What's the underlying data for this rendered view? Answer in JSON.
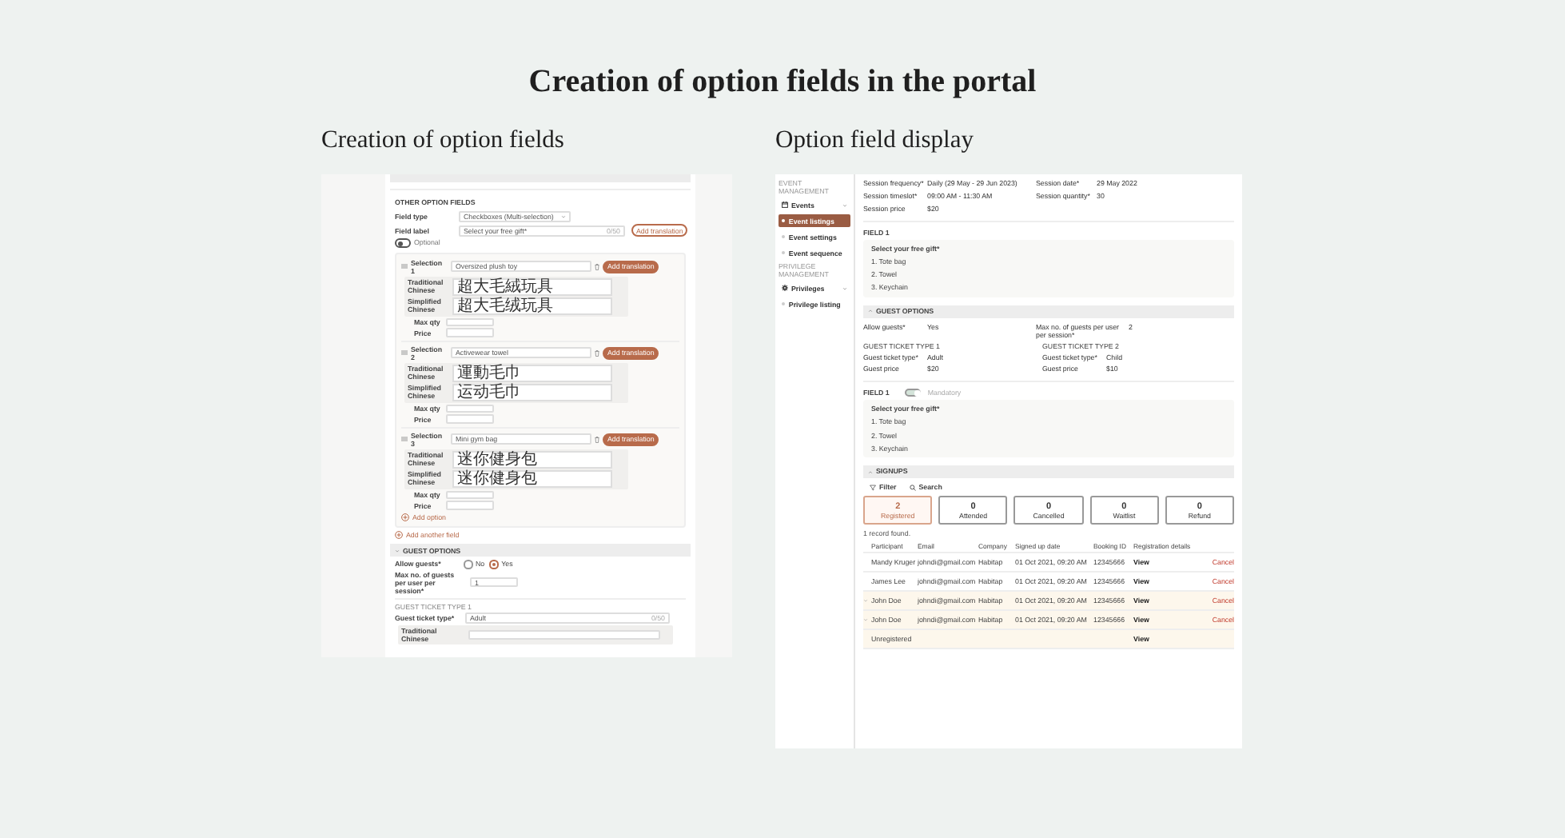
{
  "heading": "Creation of option fields in the portal",
  "creation_panel": {
    "caption": "Creation of option fields",
    "section_title": "OTHER OPTION FIELDS",
    "field_type": {
      "label": "Field type",
      "value": "Checkboxes (Multi-selection)"
    },
    "field_label": {
      "label": "Field label",
      "value": "Select your free gift*",
      "counter": "0/50",
      "button": "Add translation"
    },
    "optional_toggle": {
      "label": "Optional",
      "on": false
    },
    "selections": [
      {
        "label": "Selection 1",
        "value": "Oversized plush toy",
        "button": "Add translation",
        "translations": [
          {
            "label": "Traditional Chinese",
            "value": "超大毛絨玩具"
          },
          {
            "label": "Simplified Chinese",
            "value": "超大毛绒玩具"
          }
        ],
        "max_qty_label": "Max qty",
        "price_label": "Price"
      },
      {
        "label": "Selection 2",
        "value": "Activewear towel",
        "button": "Add translation",
        "translations": [
          {
            "label": "Traditional Chinese",
            "value": "運動毛巾"
          },
          {
            "label": "Simplified Chinese",
            "value": "运动毛巾"
          }
        ],
        "max_qty_label": "Max qty",
        "price_label": "Price"
      },
      {
        "label": "Selection 3",
        "value": "Mini gym bag",
        "button": "Add translation",
        "translations": [
          {
            "label": "Traditional Chinese",
            "value": "迷你健身包"
          },
          {
            "label": "Simplified Chinese",
            "value": "迷你健身包"
          }
        ],
        "max_qty_label": "Max qty",
        "price_label": "Price"
      }
    ],
    "add_option": "Add option",
    "add_field": "Add another field",
    "guest_options": {
      "title": "GUEST OPTIONS",
      "allow_label": "Allow guests*",
      "radios": [
        {
          "label": "No",
          "selected": false
        },
        {
          "label": "Yes",
          "selected": true
        }
      ],
      "max_label": "Max no. of guests per user per session*",
      "max_value": "1",
      "ticket_title": "GUEST TICKET TYPE 1",
      "ticket_label": "Guest ticket type*",
      "ticket_value": "Adult",
      "ticket_counter": "0/50",
      "translation_label": "Traditional Chinese"
    }
  },
  "display_panel": {
    "caption": "Option field display",
    "sidebar": [
      {
        "title": "EVENT MANAGEMENT",
        "parent": "Events",
        "items": [
          {
            "label": "Event listings",
            "selected": true
          },
          {
            "label": "Event settings",
            "selected": false
          },
          {
            "label": "Event sequence",
            "selected": false
          }
        ]
      },
      {
        "title": "PRIVILEGE MANAGEMENT",
        "parent": "Privileges",
        "items": [
          {
            "label": "Privilege listing",
            "selected": false
          }
        ]
      }
    ],
    "sections": [
      {
        "kind": "session",
        "rows": [
          {
            "label": "Session frequency*",
            "value": "Daily (29 May - 29 Jun 2023)"
          },
          {
            "label": "Session date*",
            "value": "29 May 2022"
          },
          {
            "label": "Session timeslot*",
            "value": "09:00 AM - 11:30 AM"
          },
          {
            "label": "Session quantity*",
            "value": "30"
          },
          {
            "label": "Session price",
            "value": "$20"
          }
        ]
      },
      {
        "kind": "field",
        "title": "FIELD 1",
        "question": "Select your free gift*",
        "options": [
          "1.  Tote bag",
          "2.  Towel",
          "3.  Keychain"
        ]
      },
      {
        "kind": "guest_options",
        "title": "GUEST OPTIONS",
        "rows": [
          {
            "label": "Allow guests*",
            "value": "Yes"
          },
          {
            "label": "Max no. of guests per user per session*",
            "value": "2"
          }
        ],
        "ticket_types": [
          {
            "title": "GUEST TICKET TYPE 1",
            "rows": [
              {
                "label": "Guest ticket type*",
                "value": "Adult"
              },
              {
                "label": "Guest price",
                "value": "$20"
              }
            ]
          },
          {
            "title": "GUEST TICKET TYPE 2",
            "rows": [
              {
                "label": "Guest ticket type*",
                "value": "Child"
              },
              {
                "label": "Guest price",
                "value": "$10"
              }
            ]
          }
        ]
      },
      {
        "kind": "field",
        "title": "FIELD 1",
        "toggle": {
          "label": "Mandatory",
          "on": true
        },
        "question": "Select your free gift*",
        "options": [
          "1.  Tote bag",
          "2.  Towel",
          "3.  Keychain"
        ]
      },
      {
        "kind": "signups",
        "title": "SIGNUPS",
        "filter": "Filter",
        "search": "Search",
        "stats": [
          {
            "count": "2",
            "label": "Registered",
            "selected": true
          },
          {
            "count": "0",
            "label": "Attended",
            "selected": false
          },
          {
            "count": "0",
            "label": "Cancelled",
            "selected": false
          },
          {
            "count": "0",
            "label": "Waitlist",
            "selected": false
          },
          {
            "count": "0",
            "label": "Refund",
            "selected": false
          }
        ],
        "record_text": "1 record found.",
        "columns": [
          "Participant",
          "Email",
          "Company",
          "Signed up date",
          "Booking ID",
          "Registration details"
        ],
        "rows": [
          {
            "expandable": false,
            "highlighted": false,
            "participant": "Mandy Kruger",
            "email": "johndi@gmail.com",
            "company": "Habitap",
            "date": "01 Oct 2021, 09:20 AM",
            "booking": "12345666",
            "view": "View",
            "cancel": "Cancel"
          },
          {
            "expandable": false,
            "highlighted": false,
            "participant": "James Lee",
            "email": "johndi@gmail.com",
            "company": "Habitap",
            "date": "01 Oct 2021, 09:20 AM",
            "booking": "12345666",
            "view": "View",
            "cancel": "Cancel"
          },
          {
            "expandable": true,
            "highlighted": true,
            "participant": "John Doe",
            "email": "johndi@gmail.com",
            "company": "Habitap",
            "date": "01 Oct 2021, 09:20 AM",
            "booking": "12345666",
            "view": "View",
            "cancel": "Cancel"
          },
          {
            "expandable": true,
            "highlighted": true,
            "participant": "John Doe",
            "email": "johndi@gmail.com",
            "company": "Habitap",
            "date": "01 Oct 2021, 09:20 AM",
            "booking": "12345666",
            "view": "View",
            "cancel": "Cancel"
          },
          {
            "expandable": false,
            "highlighted": true,
            "participant": "Unregistered",
            "view": "View"
          }
        ]
      }
    ]
  }
}
